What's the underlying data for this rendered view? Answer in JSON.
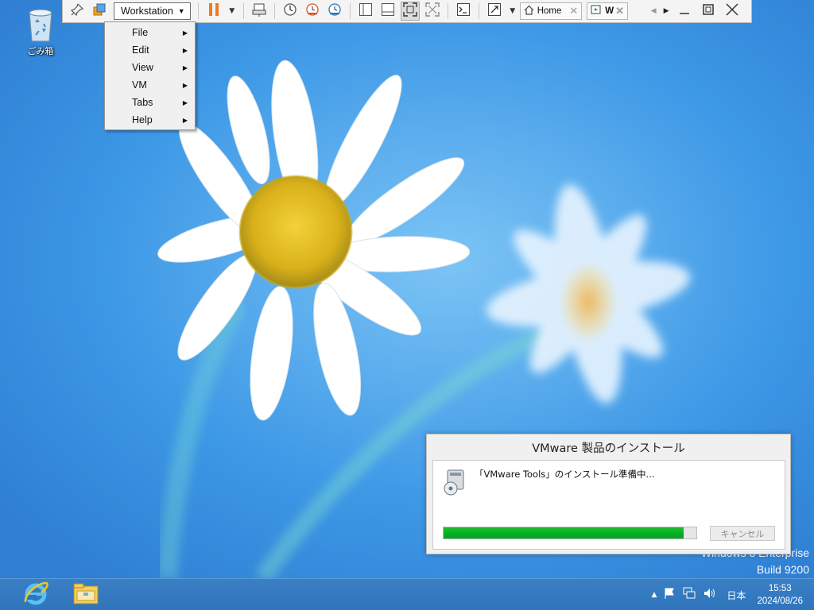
{
  "desktop": {
    "recycle_bin_label": "ごみ箱",
    "watermark_line1": "Windows 8 Enterprise",
    "watermark_line2": "Build 9200"
  },
  "vmware_toolbar": {
    "workstation_menu_label": "Workstation",
    "tabs": [
      {
        "label": "Home"
      },
      {
        "label": "W"
      }
    ]
  },
  "workstation_menu": {
    "items": [
      {
        "label": "File"
      },
      {
        "label": "Edit"
      },
      {
        "label": "View"
      },
      {
        "label": "VM"
      },
      {
        "label": "Tabs"
      },
      {
        "label": "Help"
      }
    ]
  },
  "install_dialog": {
    "title": "VMware 製品のインストール",
    "message": "「VMware Tools」のインストール準備中...",
    "progress_percent": 95,
    "cancel_label": "キャンセル"
  },
  "taskbar": {
    "apps": [
      {
        "icon": "internet-explorer-icon"
      },
      {
        "icon": "file-explorer-icon"
      }
    ],
    "language": "日本",
    "time": "15:53",
    "date": "2024/08/26"
  },
  "colors": {
    "progress_fill": "#06b025",
    "taskbar": "#2f75bb",
    "wallpaper": "#3a97ea"
  }
}
